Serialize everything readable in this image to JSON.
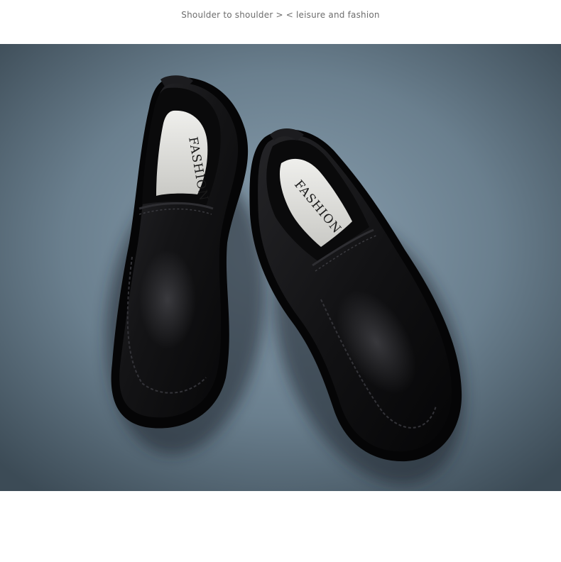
{
  "header": {
    "caption": "Shoulder to shoulder > < leisure and fashion"
  },
  "photo": {
    "subject": "pair of black leather slip-on loafers on textured grey-blue background",
    "insole_text_left": "FASHION",
    "insole_text_right": "FASHION",
    "colors": {
      "background_center": "#7f95a6",
      "background_edge": "#42535f",
      "leather": "#0d0d0f",
      "insole": "#e2e2df"
    }
  }
}
